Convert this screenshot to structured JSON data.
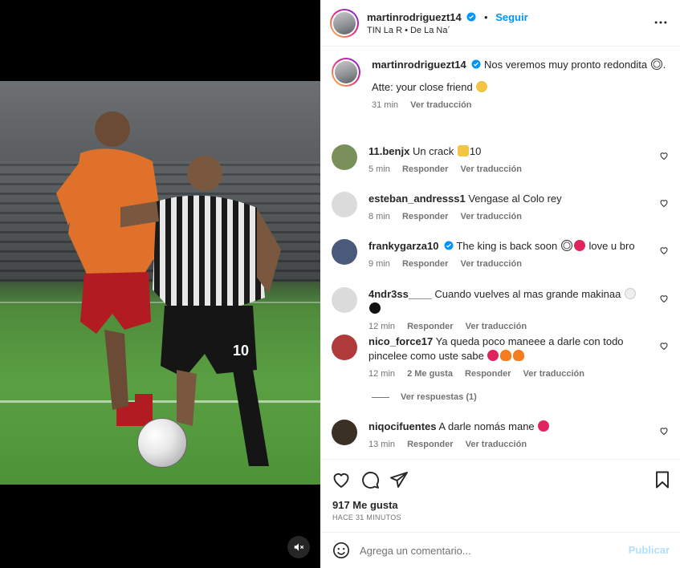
{
  "post": {
    "username": "martinrodriguezt14",
    "follow_label": "Seguir",
    "separator": "•",
    "audio_line": "TIN La R  •  De La Na´",
    "caption": {
      "username": "martinrodriguezt14",
      "text_line1": "Nos veremos muy pronto redondita",
      "text_line2": "Atte: your close friend",
      "time": "31 min",
      "translate": "Ver traducción"
    }
  },
  "comments": [
    {
      "username": "11.benjx",
      "verified": false,
      "text": "Un crack",
      "suffix": "10",
      "time": "5 min",
      "reply": "Responder",
      "translate": "Ver traducción",
      "avatar_color": "#7a8f5a"
    },
    {
      "username": "esteban_andresss1",
      "verified": false,
      "text": "Vengase al Colo rey",
      "time": "8 min",
      "reply": "Responder",
      "translate": "Ver traducción",
      "avatar_color": "#dbdbdb"
    },
    {
      "username": "frankygarza10",
      "verified": true,
      "text": "The king is back soon",
      "suffix": "love u bro",
      "time": "9 min",
      "reply": "Responder",
      "translate": "Ver traducción",
      "avatar_color": "#4a5a7a"
    },
    {
      "username": "4ndr3ss____",
      "verified": false,
      "text": "Cuando vuelves al mas grande makinaa",
      "time": "12 min",
      "reply": "Responder",
      "translate": "Ver traducción",
      "avatar_color": "#dbdbdb"
    },
    {
      "username": "nico_force17",
      "verified": false,
      "text": "Ya queda poco maneee a darle con todo pincelee como uste sabe",
      "time": "12 min",
      "likes": "2 Me gusta",
      "reply": "Responder",
      "translate": "Ver traducción",
      "avatar_color": "#b03a3a"
    },
    {
      "username": "niqocifuentes",
      "verified": false,
      "text": "A darle nomás mane",
      "time": "13 min",
      "reply": "Responder",
      "translate": "Ver traducción",
      "avatar_color": "#3b3024"
    }
  ],
  "view_replies": "Ver respuestas (1)",
  "likes_count": "917 Me gusta",
  "post_time": "HACE 31 MINUTOS",
  "composer": {
    "placeholder": "Agrega un comentario...",
    "post_label": "Publicar"
  },
  "colors": {
    "accent": "#0095f6",
    "verified": "#0095f6",
    "muted": "#737373",
    "post_disabled": "#b2dffc"
  },
  "icons": [
    "verified-badge-icon",
    "more-options-icon",
    "heart-icon",
    "comment-icon",
    "share-icon",
    "bookmark-icon",
    "emoji-icon",
    "mute-icon"
  ]
}
